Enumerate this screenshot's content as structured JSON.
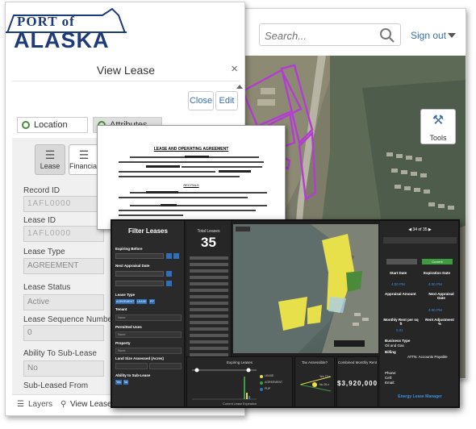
{
  "map_app": {
    "search_placeholder": "Search...",
    "signout_label": "Sign out",
    "tools_label": "Tools"
  },
  "lease_app": {
    "logo_port": "PORT of",
    "logo_alaska": "ALASKA",
    "panel_title": "View Lease",
    "close_label": "Close",
    "edit_label": "Edit",
    "tabs": [
      "Location",
      "Attributes"
    ],
    "sections": [
      "Lease",
      "Financial",
      "T"
    ],
    "fields": [
      {
        "label": "Record ID",
        "value": "1AFL0000"
      },
      {
        "label": "Lease ID",
        "value": "1AFL0000"
      },
      {
        "label": "Lease Type",
        "value": "AGREEMENT"
      },
      {
        "label": "Lease Status",
        "value": "Active"
      },
      {
        "label": "Lease Sequence Number",
        "value": "0"
      },
      {
        "label": "Ability To Sub-Lease",
        "value": "No"
      },
      {
        "label": "Sub-Leased From",
        "value": ""
      }
    ],
    "bottom_tabs": [
      "Layers",
      "View Lease"
    ]
  },
  "document": {
    "title": "LEASE AND OPERATING AGREEMENT",
    "recitals": "RECITALS",
    "closing": "NOW, THEREFORE, it is mutually agreed as follows:"
  },
  "dashboard": {
    "filter_title": "Filter Leases",
    "filter_labels": [
      "Expiring Before",
      "Next Appraisal Date",
      "Lease Type",
      "Tenant",
      "Permitted Uses",
      "Property",
      "Land Size Assessed (Acres)",
      "Ability to Sub-Lease"
    ],
    "lease_type_chips": [
      "AGREEMENT",
      "LEASE",
      "PP"
    ],
    "sublease_chips": [
      "Yes",
      "No"
    ],
    "select_none": "None",
    "total_label": "Total Leases",
    "total_value": "35",
    "pager": "34 of 35",
    "detail": {
      "start_date_label": "Start Date",
      "start_time": "4:00 PM",
      "expiration_label": "Expiration Date",
      "expiration_time": "4:00 PM",
      "appraisal_amount_label": "Appraisal Amount",
      "next_appraisal_label": "Next Appraisal Date",
      "next_appraisal_time": "4:00 PM",
      "monthly_rent_label": "Monthly Rent per sq ft",
      "monthly_rent_value": "0.01",
      "rent_adjust_label": "Rent Adjustment %",
      "business_type_label": "Business Type",
      "business_type_value": "Oil and Gas",
      "billing_label": "Billing",
      "billing_value": "ATTN: Accounts Payable",
      "phone_label": "Phone:",
      "cell_label": "Cell:",
      "email_label": "Email:",
      "status_pill": "Current"
    },
    "energy_link": "Energy Lease Manager",
    "expiring_title": "Expiring Leases",
    "expiring_xlabel": "Current Lease Expiration",
    "expiring_legend": [
      "LEASE",
      "AGREEMENT",
      "PUP"
    ],
    "tax_title": "Tax Assessible?",
    "tax_legend": [
      "Yes 73.x",
      "No 26.x"
    ],
    "rent_title": "Combined Monthly Rent",
    "rent_value": "$3,920,000"
  },
  "colors": {
    "brand_navy": "#1d3b79",
    "link_blue": "#3a6ea5",
    "lease_polygon": "#b43cd2",
    "dash_yellow": "#e8e04a",
    "dash_blue": "#2e6fb8",
    "dash_green": "#3f9b3f"
  }
}
